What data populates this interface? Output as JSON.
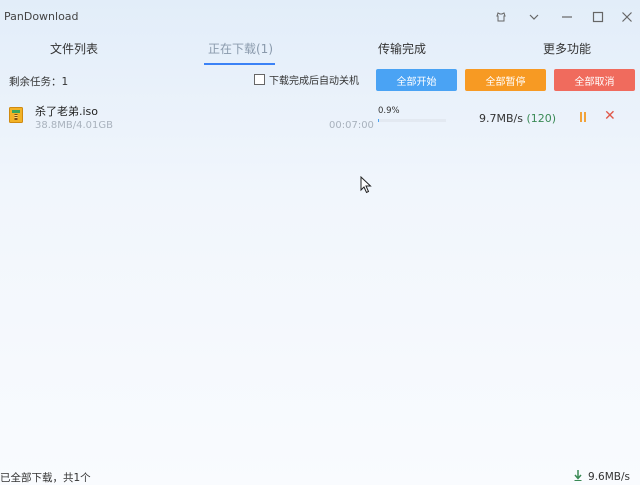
{
  "window": {
    "title": "PanDownload"
  },
  "tabs": [
    {
      "label": "文件列表"
    },
    {
      "label": "正在下载(1)"
    },
    {
      "label": "传输完成"
    },
    {
      "label": "更多功能"
    }
  ],
  "toolbar": {
    "remaining": "剩余任务：1",
    "shutdown_label": "下载完成后自动关机",
    "shutdown_checked": false,
    "start_all": "全部开始",
    "pause_all": "全部暂停",
    "cancel_all": "全部取消"
  },
  "downloads": [
    {
      "name": "杀了老弟.iso",
      "size": "38.8MB/4.01GB",
      "time_left": "00:07:00",
      "percent_text": "0.9%",
      "progress": 0.009,
      "speed": "9.7MB/s",
      "connections": "(120)"
    }
  ],
  "status": {
    "left": "已全部下载，共1个",
    "total_speed": "9.6MB/s"
  },
  "colors": {
    "accent": "#3b82f6",
    "start": "#4aa3f4",
    "pause": "#f79a23",
    "cancel": "#f06b5d"
  }
}
